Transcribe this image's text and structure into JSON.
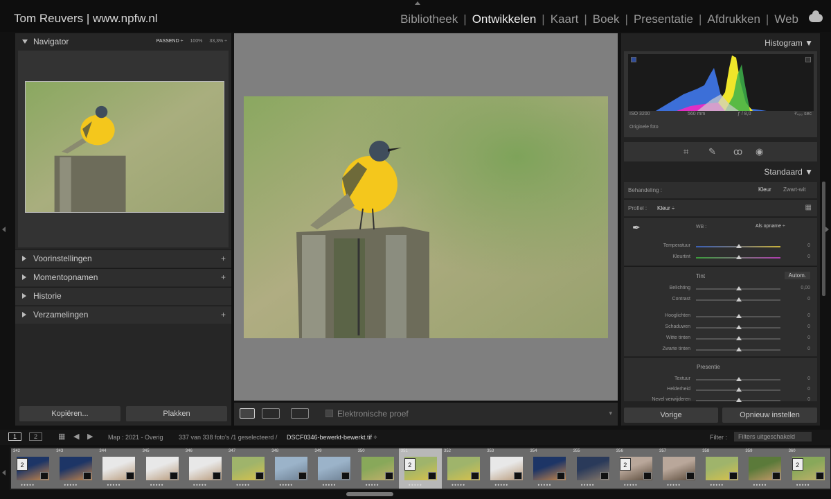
{
  "app": {
    "brand": "Tom Reuvers | www.npfw.nl"
  },
  "modules": [
    {
      "label": "Bibliotheek",
      "active": false
    },
    {
      "label": "Ontwikkelen",
      "active": true
    },
    {
      "label": "Kaart",
      "active": false
    },
    {
      "label": "Boek",
      "active": false
    },
    {
      "label": "Presentatie",
      "active": false
    },
    {
      "label": "Afdrukken",
      "active": false
    },
    {
      "label": "Web",
      "active": false
    }
  ],
  "left": {
    "navigator": {
      "title": "Navigator",
      "zoom_options": [
        "PASSEND ÷",
        "100%",
        "33,3% ÷"
      ]
    },
    "sections": [
      {
        "label": "Voorinstellingen",
        "plus": "+"
      },
      {
        "label": "Momentopnamen",
        "plus": "+"
      },
      {
        "label": "Historie",
        "plus": ""
      },
      {
        "label": "Verzamelingen",
        "plus": "+"
      }
    ],
    "copy_button": "Kopiëren...",
    "paste_button": "Plakken"
  },
  "toolbar": {
    "proof_label": "Elektronische proef"
  },
  "right": {
    "histogram": {
      "title": "Histogram",
      "iso": "ISO 3200",
      "focal": "560 mm",
      "aperture": "ƒ / 8,0",
      "shutter": "¹⁄₄₀₀ sec",
      "original": "Originele foto"
    },
    "profile_mode": "Standaard ▼",
    "treatment": {
      "label": "Behandeling :",
      "color": "Kleur",
      "bw": "Zwart-wit"
    },
    "profile": {
      "label": "Profiel :",
      "value": "Kleur ÷"
    },
    "wb": {
      "label": "WB :",
      "value": "Als opname ÷"
    },
    "basic_sliders": [
      {
        "label": "Temperatuur",
        "value": "0"
      },
      {
        "label": "Kleurtint",
        "value": "0"
      }
    ],
    "tone": {
      "label": "Tint",
      "auto": "Autom."
    },
    "tone_sliders": [
      {
        "label": "Belichting",
        "value": "0,00"
      },
      {
        "label": "Contrast",
        "value": "0"
      },
      {
        "label": "Hooglichten",
        "value": "0"
      },
      {
        "label": "Schaduwen",
        "value": "0"
      },
      {
        "label": "Witte tinten",
        "value": "0"
      },
      {
        "label": "Zwarte tinten",
        "value": "0"
      }
    ],
    "presence": {
      "label": "Presentie"
    },
    "presence_sliders": [
      {
        "label": "Textuur",
        "value": "0"
      },
      {
        "label": "Helderheid",
        "value": "0"
      },
      {
        "label": "Nevel verwijderen",
        "value": "0"
      }
    ],
    "prev_button": "Vorige",
    "reset_button": "Opnieuw instellen"
  },
  "filmbar": {
    "page1": "1",
    "page2": "2",
    "source": "Map : 2021 - Overig",
    "count": "337 van 338 foto's /1 geselecteerd /",
    "filename": "DSCF0346-bewerkt-bewerkt.tif ÷",
    "filter_label": "Filter :",
    "filter_value": "Filters uitgeschakeld"
  },
  "filmstrip": [
    {
      "num": "342",
      "badge": "2",
      "scene": "sunset",
      "sel": false
    },
    {
      "num": "343",
      "badge": "",
      "scene": "sunset",
      "sel": false
    },
    {
      "num": "344",
      "badge": "",
      "scene": "white",
      "sel": false
    },
    {
      "num": "345",
      "badge": "",
      "scene": "white",
      "sel": false
    },
    {
      "num": "346",
      "badge": "",
      "scene": "white",
      "sel": false
    },
    {
      "num": "347",
      "badge": "",
      "scene": "green",
      "sel": false
    },
    {
      "num": "348",
      "badge": "",
      "scene": "water",
      "sel": false
    },
    {
      "num": "349",
      "badge": "",
      "scene": "water",
      "sel": false
    },
    {
      "num": "350",
      "badge": "",
      "scene": "meadow",
      "sel": false
    },
    {
      "num": "351",
      "badge": "2",
      "scene": "green",
      "sel": true
    },
    {
      "num": "352",
      "badge": "",
      "scene": "green",
      "sel": false
    },
    {
      "num": "353",
      "badge": "",
      "scene": "white",
      "sel": false
    },
    {
      "num": "354",
      "badge": "",
      "scene": "sunset",
      "sel": false
    },
    {
      "num": "355",
      "badge": "",
      "scene": "dusk",
      "sel": false
    },
    {
      "num": "356",
      "badge": "2",
      "scene": "rock",
      "sel": false
    },
    {
      "num": "357",
      "badge": "",
      "scene": "rock",
      "sel": false
    },
    {
      "num": "358",
      "badge": "",
      "scene": "green",
      "sel": false
    },
    {
      "num": "359",
      "badge": "",
      "scene": "dog",
      "sel": false
    },
    {
      "num": "360",
      "badge": "2",
      "scene": "meadow",
      "sel": false
    }
  ],
  "colors": {
    "yellow": "#f4c71c",
    "bg_green": "#8aa860"
  }
}
